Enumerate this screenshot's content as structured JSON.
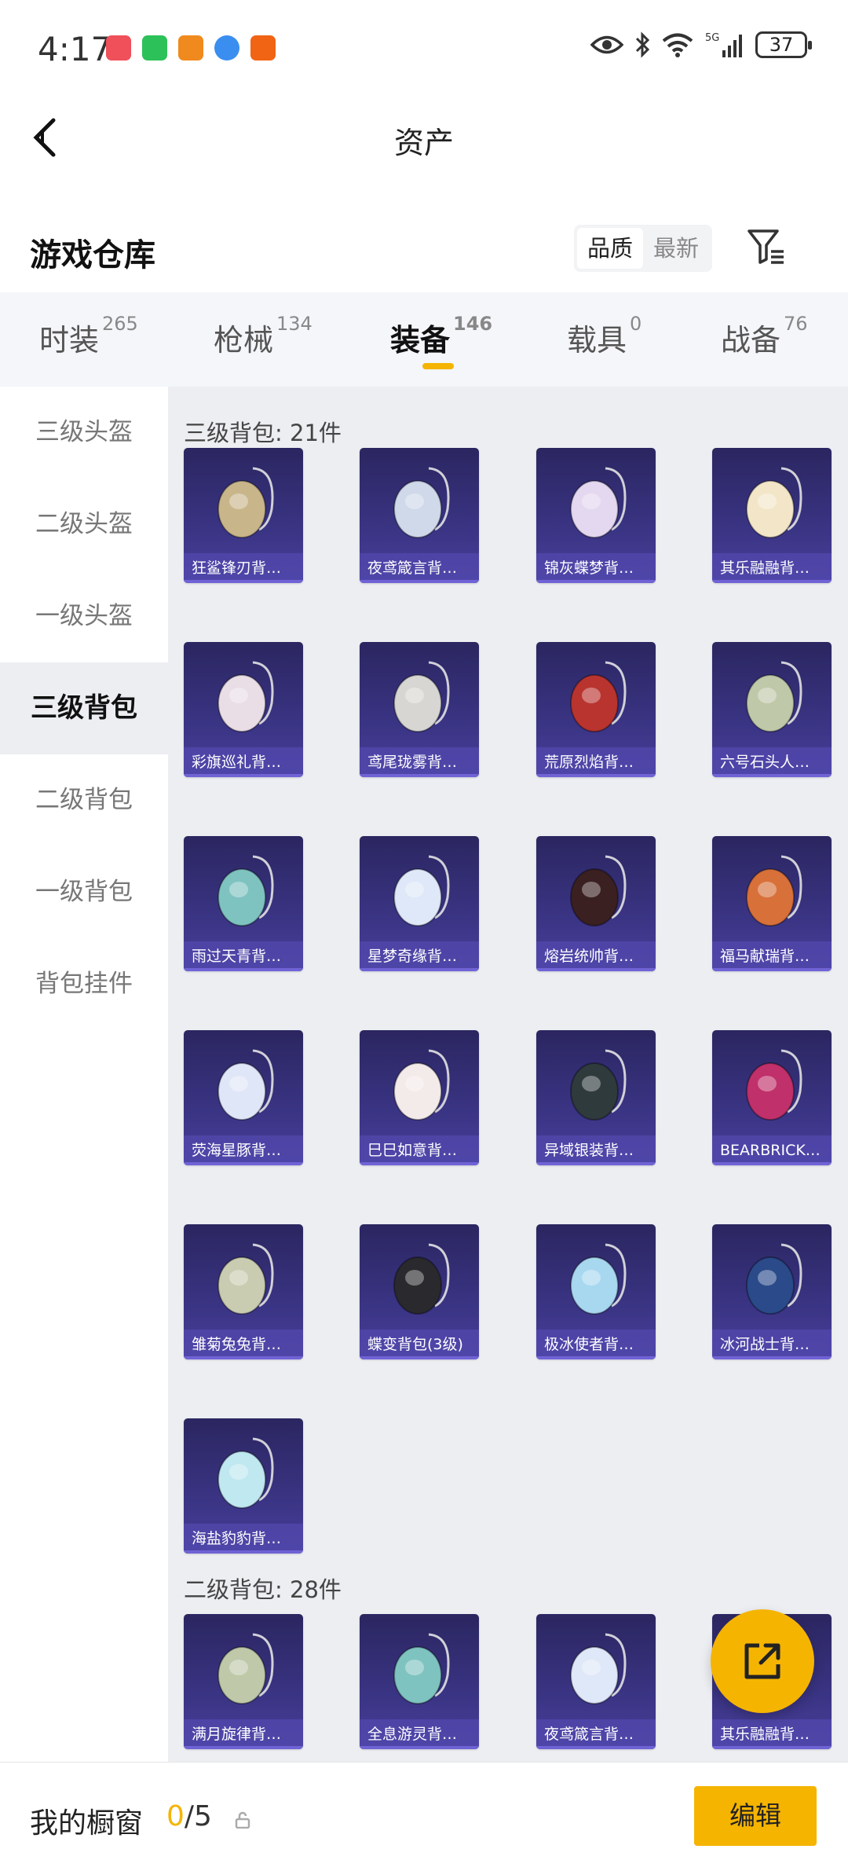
{
  "status_bar": {
    "time": "4:17",
    "battery": "37",
    "network": "5G"
  },
  "header": {
    "title": "资产"
  },
  "warehouse": {
    "title": "游戏仓库",
    "sort_options": [
      "品质",
      "最新"
    ],
    "active_sort": "品质"
  },
  "tabs": [
    {
      "label": "时装",
      "count": "265"
    },
    {
      "label": "枪械",
      "count": "134"
    },
    {
      "label": "装备",
      "count": "146"
    },
    {
      "label": "载具",
      "count": "0"
    },
    {
      "label": "战备",
      "count": "76"
    }
  ],
  "sidebar": {
    "items": [
      "三级头盔",
      "二级头盔",
      "一级头盔",
      "三级背包",
      "二级背包",
      "一级背包",
      "背包挂件"
    ],
    "active": "三级背包"
  },
  "sections": [
    {
      "title": "三级背包: 21件",
      "items": [
        "狂鲨锋刃背…",
        "夜鸢箴言背…",
        "锦灰蝶梦背…",
        "其乐融融背…",
        "彩旗巡礼背…",
        "鸢尾珑雾背…",
        "荒原烈焰背…",
        "六号石头人…",
        "雨过天青背…",
        "星梦奇缘背…",
        "熔岩统帅背…",
        "福马献瑞背…",
        "荧海星豚背…",
        "巳巳如意背…",
        "异域银装背…",
        "BEARBRICK…",
        "雏菊兔兔背…",
        "蝶变背包(3级)",
        "极冰使者背…",
        "冰河战士背…",
        "海盐豹豹背…"
      ]
    },
    {
      "title": "二级背包: 28件",
      "items": [
        "满月旋律背…",
        "全息游灵背…",
        "夜鸢箴言背…",
        "其乐融融背…"
      ]
    }
  ],
  "footer": {
    "label": "我的橱窗",
    "current": "0",
    "total": "/5",
    "edit_label": "编辑"
  },
  "colors": {
    "accent": "#f5b400",
    "card_bg": "#2b2660",
    "card_label_bg": "#5046aa"
  }
}
